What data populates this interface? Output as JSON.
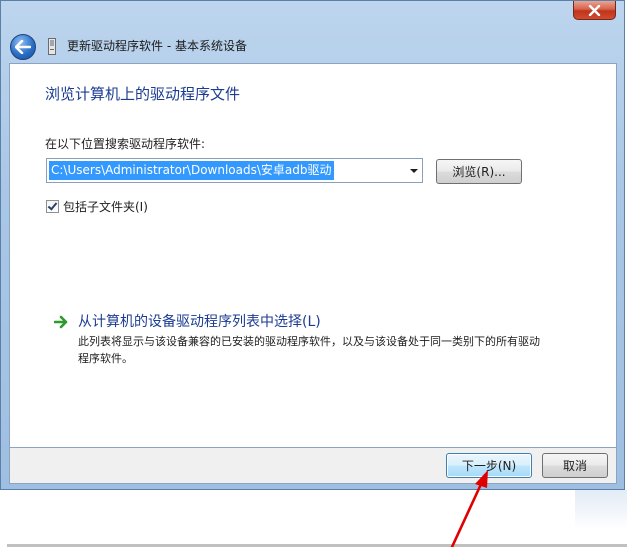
{
  "window": {
    "title": "更新驱动程序软件 - 基本系统设备",
    "close_label": "✕"
  },
  "content": {
    "heading": "浏览计算机上的驱动程序文件",
    "search_label": "在以下位置搜索驱动程序软件:",
    "path_value": "C:\\Users\\Administrator\\Downloads\\安卓adb驱动",
    "browse_label": "浏览(R)...",
    "include_subfolders_label": "包括子文件夹(I)",
    "include_subfolders_checked": true,
    "pick_option": {
      "title": "从计算机的设备驱动程序列表中选择(L)",
      "description": "此列表将显示与该设备兼容的已安装的驱动程序软件，以及与该设备处于同一类别下的所有驱动程序软件。"
    }
  },
  "footer": {
    "next_label": "下一步(N)",
    "cancel_label": "取消"
  },
  "colors": {
    "heading": "#1c3c92",
    "selection": "#3399ff",
    "annotation_arrow": "#e00000",
    "close_button": "#c0331b"
  },
  "icons": {
    "back": "back-arrow-icon",
    "device": "device-icon",
    "option_arrow": "green-arrow-icon",
    "close": "close-icon",
    "dropdown": "chevron-down-icon"
  }
}
